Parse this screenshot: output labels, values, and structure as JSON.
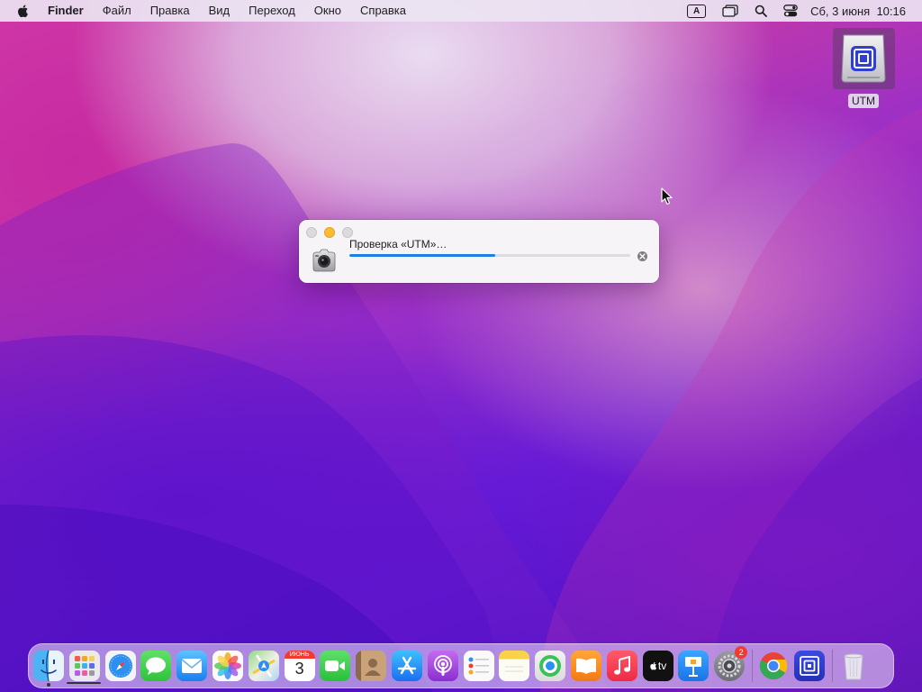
{
  "menubar": {
    "apple_icon": "apple-logo-icon",
    "app_name": "Finder",
    "items": [
      "Файл",
      "Правка",
      "Вид",
      "Переход",
      "Окно",
      "Справка"
    ],
    "input_source": "A",
    "status_icons": [
      "input-source-icon",
      "stage-manager-icon",
      "spotlight-search-icon",
      "control-center-icon"
    ],
    "date": "Сб, 3 июня",
    "time": "10:16"
  },
  "desktop": {
    "disk_label": "UTM"
  },
  "verify_window": {
    "message": "Проверка «UTM»…",
    "progress": 0.52,
    "accent": "#1d7fe5"
  },
  "dock": {
    "apps": [
      {
        "name": "finder",
        "icon": "finder-icon",
        "running": true
      },
      {
        "name": "launchpad",
        "icon": "launchpad-icon"
      },
      {
        "name": "safari",
        "icon": "safari-icon"
      },
      {
        "name": "messages",
        "icon": "messages-icon"
      },
      {
        "name": "mail",
        "icon": "mail-icon"
      },
      {
        "name": "photos",
        "icon": "photos-icon"
      },
      {
        "name": "maps",
        "icon": "maps-icon"
      },
      {
        "name": "calendar",
        "icon": "calendar-icon",
        "month": "ИЮНЬ",
        "day": "3"
      },
      {
        "name": "facetime",
        "icon": "facetime-icon"
      },
      {
        "name": "contacts",
        "icon": "contacts-icon"
      },
      {
        "name": "app-store",
        "icon": "app-store-icon"
      },
      {
        "name": "podcasts",
        "icon": "podcasts-icon"
      },
      {
        "name": "reminders",
        "icon": "reminders-icon"
      },
      {
        "name": "notes",
        "icon": "notes-icon"
      },
      {
        "name": "find-my",
        "icon": "find-my-icon"
      },
      {
        "name": "books",
        "icon": "books-icon"
      },
      {
        "name": "music",
        "icon": "music-icon"
      },
      {
        "name": "apple-tv",
        "icon": "apple-tv-icon",
        "label": "tv"
      },
      {
        "name": "keynote",
        "icon": "keynote-icon"
      },
      {
        "name": "system-settings",
        "icon": "system-settings-icon",
        "badge": "2"
      },
      {
        "name": "chrome",
        "icon": "chrome-icon"
      },
      {
        "name": "utm",
        "icon": "utm-icon"
      },
      {
        "name": "trash",
        "icon": "trash-icon"
      }
    ]
  }
}
